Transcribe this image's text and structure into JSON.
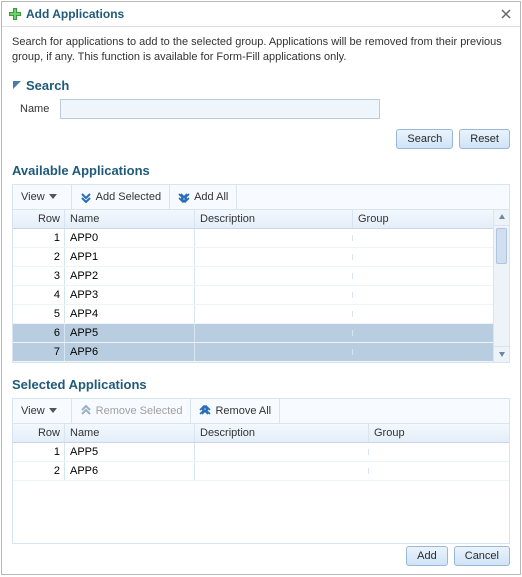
{
  "dialog": {
    "title": "Add Applications",
    "instructions": "Search for applications to add to the selected group. Applications will be removed from their previous group, if any. This function is available for Form-Fill applications only."
  },
  "search": {
    "section_label": "Search",
    "name_label": "Name",
    "value": "",
    "search_btn": "Search",
    "reset_btn": "Reset"
  },
  "available": {
    "section_label": "Available Applications",
    "view_btn": "View",
    "add_selected_btn": "Add Selected",
    "add_all_btn": "Add All",
    "columns": {
      "row": "Row",
      "name": "Name",
      "desc": "Description",
      "group": "Group"
    },
    "rows": [
      {
        "row": "1",
        "name": "APP0",
        "desc": "",
        "group": "",
        "selected": false
      },
      {
        "row": "2",
        "name": "APP1",
        "desc": "",
        "group": "",
        "selected": false
      },
      {
        "row": "3",
        "name": "APP2",
        "desc": "",
        "group": "",
        "selected": false
      },
      {
        "row": "4",
        "name": "APP3",
        "desc": "",
        "group": "",
        "selected": false
      },
      {
        "row": "5",
        "name": "APP4",
        "desc": "",
        "group": "",
        "selected": false
      },
      {
        "row": "6",
        "name": "APP5",
        "desc": "",
        "group": "",
        "selected": true
      },
      {
        "row": "7",
        "name": "APP6",
        "desc": "",
        "group": "",
        "selected": true
      }
    ]
  },
  "selected": {
    "section_label": "Selected Applications",
    "view_btn": "View",
    "remove_selected_btn": "Remove Selected",
    "remove_all_btn": "Remove All",
    "columns": {
      "row": "Row",
      "name": "Name",
      "desc": "Description",
      "group": "Group"
    },
    "rows": [
      {
        "row": "1",
        "name": "APP5",
        "desc": "",
        "group": ""
      },
      {
        "row": "2",
        "name": "APP6",
        "desc": "",
        "group": ""
      }
    ]
  },
  "footer": {
    "add_btn": "Add",
    "cancel_btn": "Cancel"
  }
}
